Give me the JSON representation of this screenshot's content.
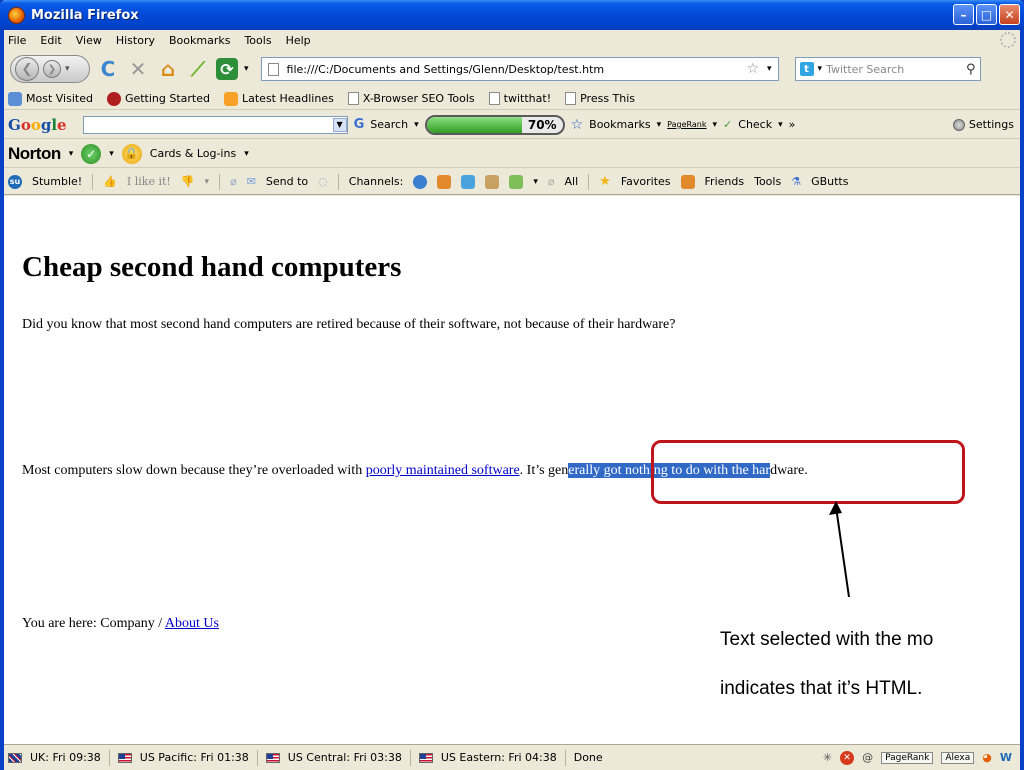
{
  "window": {
    "title": "Mozilla Firefox"
  },
  "menu": [
    "File",
    "Edit",
    "View",
    "History",
    "Bookmarks",
    "Tools",
    "Help"
  ],
  "nav": {
    "url": "file:///C:/Documents and Settings/Glenn/Desktop/test.htm",
    "search_placeholder": "Twitter Search"
  },
  "bookmarks": [
    "Most Visited",
    "Getting Started",
    "Latest Headlines",
    "X-Browser SEO Tools",
    "twitthat!",
    "Press This"
  ],
  "google_toolbar": {
    "logo": "Google",
    "search_label": "Search",
    "progress_text": "70%",
    "progress_value": 70,
    "bookmarks_label": "Bookmarks",
    "pagerank_label": "PageRank",
    "check_label": "Check",
    "more": "»",
    "settings_label": "Settings"
  },
  "norton_toolbar": {
    "logo": "Norton",
    "cards_label": "Cards & Log-ins"
  },
  "stumble_toolbar": {
    "stumble": "Stumble!",
    "like": "I like it!",
    "send_to": "Send to",
    "channels": "Channels:",
    "all": "All",
    "favorites": "Favorites",
    "friends": "Friends",
    "tools": "Tools",
    "gbutts": "GButts"
  },
  "page": {
    "heading": "Cheap second hand computers",
    "para1": "Did you know that most second hand computers are retired because of their software, not because of their hardware?",
    "para2_before": "Most computers slow down because they’re overloaded with ",
    "para2_link": "poorly maintained software",
    "para2_mid1": ". It’s gen",
    "para2_selected": "erally got nothing to do with the har",
    "para2_after": "dware.",
    "breadcrumb_prefix": "You are here: Company / ",
    "breadcrumb_link": "About Us",
    "annotation_line1": "Text selected with the mo",
    "annotation_line2": "indicates that it’s HTML.",
    "annotation_color": "#c0141c",
    "selection_color": "#3169c6"
  },
  "status": {
    "clocks": [
      "UK: Fri 09:38",
      "US Pacific: Fri 01:38",
      "US Central: Fri 03:38",
      "US Eastern: Fri 04:38"
    ],
    "done": "Done",
    "pagerank": "PageRank",
    "alexa": "Alexa"
  }
}
